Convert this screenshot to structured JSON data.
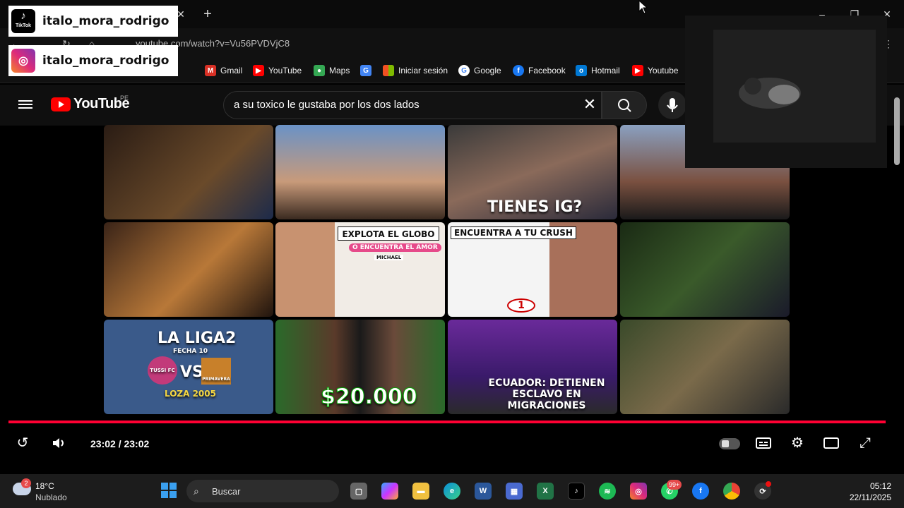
{
  "social": {
    "tiktok": {
      "icon": "tiktok-icon",
      "label_small": "TikTok",
      "handle": "italo_mora_rodrigo"
    },
    "instagram": {
      "icon": "instagram-icon",
      "handle": "italo_mora_rodrigo"
    }
  },
  "browser": {
    "url": "youtube.com/watch?v=Vu56PVDVjC8",
    "bookmarks": [
      {
        "label": "Gmail",
        "icon": "gmail-icon",
        "color": "#d93025"
      },
      {
        "label": "YouTube",
        "icon": "youtube-icon",
        "color": "#ff0000"
      },
      {
        "label": "Maps",
        "icon": "maps-icon",
        "color": "#34a853"
      },
      {
        "label": "",
        "icon": "translate-icon",
        "color": "#4285f4"
      },
      {
        "label": "Iniciar sesión",
        "icon": "microsoft-icon",
        "color": "#7fba00"
      },
      {
        "label": "Google",
        "icon": "google-icon",
        "color": "#4285f4"
      },
      {
        "label": "Facebook",
        "icon": "facebook-icon",
        "color": "#1877f2"
      },
      {
        "label": "Hotmail",
        "icon": "outlook-icon",
        "color": "#0078d4"
      },
      {
        "label": "Youtube",
        "icon": "youtube-icon",
        "color": "#ff0000"
      }
    ]
  },
  "youtube": {
    "logo_text": "YouTube",
    "country": "PE",
    "search_query": "a su toxico le gustaba por los dos lados"
  },
  "grid": {
    "captions": [
      "",
      "",
      "TIENES IG?",
      "",
      "",
      "EXPLOTA EL GLOBO",
      "ENCUENTRA A TU CRUSH",
      "",
      "LA LIGA2",
      "$20.000",
      "ECUADOR: DETIENEN ESCLAVO EN MIGRACIONES",
      ""
    ],
    "subcaptions": {
      "globo": "O ENCUENTRA EL AMOR",
      "globo_name": "MICHAEL",
      "liga_fecha": "FECHA 10",
      "liga_vs": "VS",
      "liga_team": "TUSSI FC",
      "liga_team2": "PRIMAVERA",
      "liga_place": "LOZA 2005",
      "crush_num": "1"
    }
  },
  "player": {
    "time": "23:02 / 23:02",
    "progress_fraction": 1.0
  },
  "taskbar": {
    "weather_badge": "2",
    "temp": "18°C",
    "condition": "Nublado",
    "search_placeholder": "Buscar",
    "whatsapp_badge": "99+",
    "time": "05:12",
    "date": "22/11/2025"
  }
}
